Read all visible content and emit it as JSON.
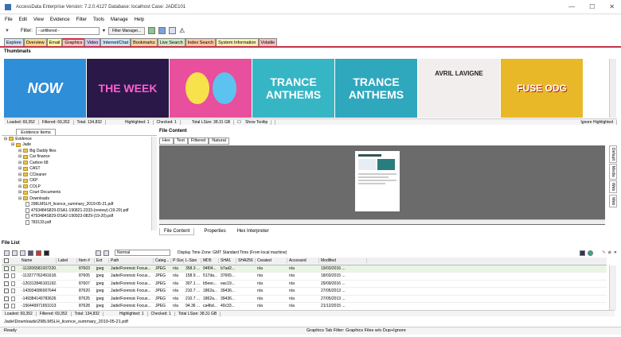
{
  "window": {
    "title": "AccessData Enterprise Version: 7.2.0.4127 Database: localhost Case: JADE101",
    "min": "—",
    "max": "☐",
    "close": "✕"
  },
  "menu": [
    "File",
    "Edit",
    "View",
    "Evidence",
    "Filter",
    "Tools",
    "Manage",
    "Help"
  ],
  "toolbar": {
    "filter_label": "Filter:",
    "filter_value": "- unfiltered -",
    "filter_manager": "Filter Manager..."
  },
  "tabs": [
    {
      "label": "Explore",
      "color": "#cfe1f5"
    },
    {
      "label": "Overview",
      "color": "#f6d98a"
    },
    {
      "label": "Email",
      "color": "#fff7a8"
    },
    {
      "label": "Graphics",
      "color": "#f7c4c4"
    },
    {
      "label": "Video",
      "color": "#d6c8ef"
    },
    {
      "label": "Internet/Chat",
      "color": "#cbe7f7"
    },
    {
      "label": "Bookmarks",
      "color": "#f5d3a4"
    },
    {
      "label": "Live Search",
      "color": "#cfe9c7"
    },
    {
      "label": "Index Search",
      "color": "#f9c7a0"
    },
    {
      "label": "System Information",
      "color": "#f7f0b5"
    },
    {
      "label": "Volatile",
      "color": "#f4c2c2"
    }
  ],
  "thumbnails": {
    "title": "Thumbnails",
    "items": [
      {
        "text": "NOW",
        "bg": "#2e8ed8"
      },
      {
        "text": "THE WEEK",
        "bg": "#2a1848"
      },
      {
        "text": "",
        "bg": "#e84f9c"
      },
      {
        "text": "TRANCE ANTHEMS",
        "bg": "#36b6c4"
      },
      {
        "text": "TRANCE ANTHEMS",
        "bg": "#2fa8bd"
      },
      {
        "text": "AVRIL LAVIGNE",
        "bg": "#f2eeee"
      },
      {
        "text": "FUSE ODG",
        "bg": "#e9b828"
      }
    ],
    "status": {
      "loaded": "Loaded: 69,352",
      "filtered": "Filtered: 69,352",
      "total": "Total: 134,832",
      "highlighted": "Highlighted: 1",
      "checked": "Checked: 1",
      "lsize": "Total LSize: 38.31 GB",
      "tooltip": "Show Tooltip",
      "ignore": "Ignore Highlighted"
    }
  },
  "evidence": {
    "tab": "Evidence Items",
    "items": [
      {
        "label": "Evidence",
        "indent": 0,
        "kind": "root"
      },
      {
        "label": "Jade",
        "indent": 1,
        "kind": "folder"
      },
      {
        "label": "Big Daddy files",
        "indent": 2,
        "kind": "folder"
      },
      {
        "label": "Car finance",
        "indent": 2,
        "kind": "folder"
      },
      {
        "label": "Carbon 68",
        "indent": 2,
        "kind": "folder"
      },
      {
        "label": "CAST",
        "indent": 2,
        "kind": "folder"
      },
      {
        "label": "CCleaner",
        "indent": 2,
        "kind": "folder"
      },
      {
        "label": "CKP",
        "indent": 2,
        "kind": "folder"
      },
      {
        "label": "COLP",
        "indent": 2,
        "kind": "folder"
      },
      {
        "label": "Court Documents",
        "indent": 2,
        "kind": "folder"
      },
      {
        "label": "Downloads",
        "indent": 2,
        "kind": "folder"
      },
      {
        "label": "298LMSLH_licence_summary_2019-05-21.pdf",
        "indent": 3,
        "kind": "pdf"
      },
      {
        "label": "4793484S829-DSA1-190821-2333-(review)-(19-20).pdf",
        "indent": 3,
        "kind": "pdf"
      },
      {
        "label": "4793484S829-DSA2-190923-0829-(19-20).pdf",
        "indent": 3,
        "kind": "pdf"
      },
      {
        "label": "783133.pdf",
        "indent": 3,
        "kind": "pdf"
      }
    ]
  },
  "filecontent": {
    "title": "File Content",
    "tabs": [
      "Hex",
      "Text",
      "Filtered",
      "Natural"
    ],
    "bottom_tabs": [
      "File Content",
      "Properties",
      "Hex Interpreter"
    ],
    "side_tabs": [
      "Default",
      "Media",
      "Web",
      "Web"
    ]
  },
  "filelist": {
    "title": "File List",
    "normal": "Normal",
    "timezone": "Display Time Zone: GMT Standard Time  (From local machine)",
    "columns": [
      "Name",
      "Label",
      "Item #",
      "Ext",
      "Path",
      "Categ...",
      "P-Size",
      "L-Size",
      "MD5",
      "SHA1",
      "SHA256",
      "Created",
      "Accessed",
      "Modified"
    ],
    "rows": [
      [
        "-113206581937220...",
        "",
        "87603",
        "jpeg",
        "Jade/Forensic Focus...",
        "JPEG",
        "n/a",
        "358.3 ...",
        "94f04...",
        "b7ad2...",
        "",
        "n/a",
        "n/a",
        "19/03/2016 ..."
      ],
      [
        "-113277762491618...",
        "",
        "87605",
        "jpeg",
        "Jade/Forensic Focus...",
        "JPEG",
        "n/a",
        "158.9 ...",
        "517da...",
        "37665...",
        "",
        "n/a",
        "n/a",
        "18/03/2015 ..."
      ],
      [
        "-120312846101192...",
        "",
        "87607",
        "jpeg",
        "Jade/Forensic Focus...",
        "JPEG",
        "n/a",
        "307.1 ...",
        "b5eec...",
        "eac19...",
        "",
        "n/a",
        "n/a",
        "29/09/2016 ..."
      ],
      [
        "-143934086007644...",
        "",
        "87620",
        "jpeg",
        "Jade/Forensic Focus...",
        "JPEG",
        "n/a",
        "210.7 ...",
        "1862a...",
        "39436...",
        "",
        "n/a",
        "n/a",
        "27/05/2013 ..."
      ],
      [
        "-149384149783626...",
        "",
        "87625",
        "jpeg",
        "Jade/Forensic Focus...",
        "JPEG",
        "n/a",
        "210.7 ...",
        "1862a...",
        "39436...",
        "",
        "n/a",
        "n/a",
        "27/05/2013 ..."
      ],
      [
        "-156449971651013...",
        "",
        "87628",
        "jpeg",
        "Jade/Forensic Focus...",
        "JPEG",
        "n/a",
        "94.36 ...",
        "ca4bd...",
        "40c33...",
        "",
        "n/a",
        "n/a",
        "21/12/2015 ..."
      ]
    ],
    "status": {
      "loaded": "Loaded: 69,352",
      "filtered": "Filtered: 69,352",
      "total": "Total: 134,832",
      "highlighted": "Highlighted: 1",
      "checked": "Checked: 1",
      "lsize": "Total LSize: 38.31 GB"
    }
  },
  "footer": {
    "path": "Jade\\Downloads\\298LMSLH_licence_summary_2019-05-21.pdf",
    "ready": "Ready",
    "filter": "Graphics Tab Filter: Graphics Files w/o Dup+Ignore"
  }
}
